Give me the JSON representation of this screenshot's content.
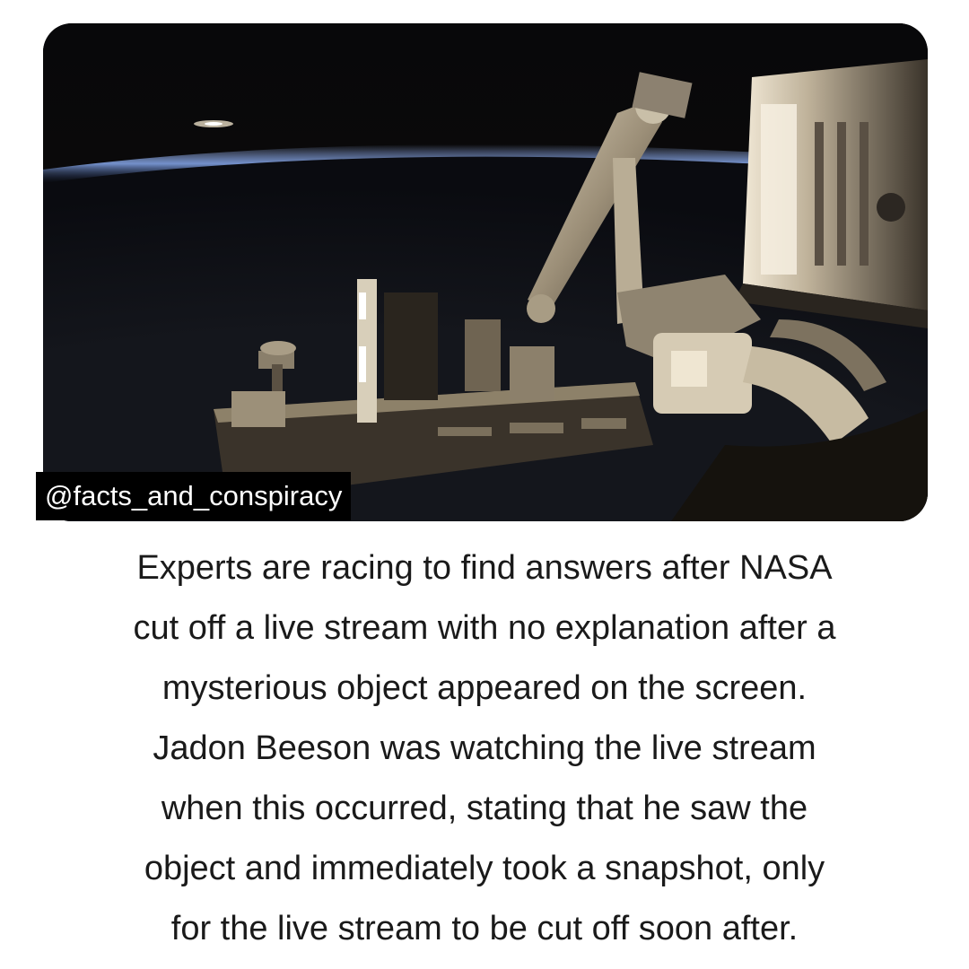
{
  "post": {
    "watermark": "@facts_and_conspiracy",
    "photo": {
      "subject": "space-station-robotic-arm-over-earth-horizon",
      "unidentified_object_icon": "bright-streak-icon"
    },
    "caption_lines": [
      "Experts are racing to find answers after NASA",
      "cut off a live stream with no explanation after a",
      "mysterious object appeared on the screen.",
      "Jadon Beeson was watching the live stream",
      "when this occurred, stating that he saw the",
      "object and immediately took a snapshot, only",
      "for the live stream to be cut off soon after."
    ]
  },
  "colors": {
    "background": "#ffffff",
    "text": "#1a1a1a",
    "watermark_bg": "#000000",
    "watermark_text": "#ffffff",
    "space": "#0c0b08",
    "earth_glow": "#6f8fd6"
  }
}
